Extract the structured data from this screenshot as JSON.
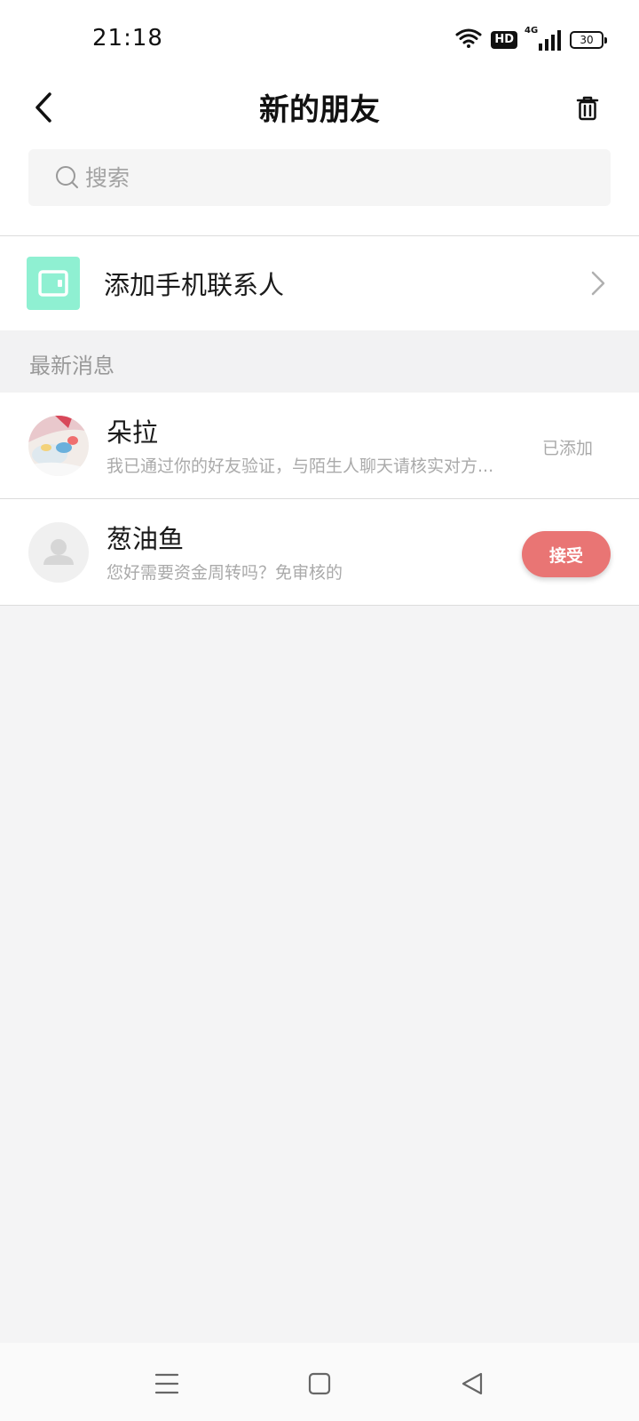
{
  "status_bar": {
    "time": "21:18",
    "hd_label": "HD",
    "network": "4G",
    "battery": "30"
  },
  "header": {
    "title": "新的朋友",
    "back_icon": "back-arrow-icon",
    "trash_icon": "trash-icon"
  },
  "search": {
    "placeholder": "搜索",
    "value": ""
  },
  "add_contact": {
    "label": "添加手机联系人",
    "icon": "contacts-book-icon",
    "icon_color": "#8ff0d2"
  },
  "section": {
    "label": "最新消息"
  },
  "friends": [
    {
      "name": "朵拉",
      "message": "我已通过你的好友验证，与陌生人聊天请核实对方...",
      "status": "已添加",
      "avatar": "photo"
    },
    {
      "name": "葱油鱼",
      "message": "您好需要资金周转吗？免审核的",
      "action": "接受",
      "avatar": "default-user-icon"
    }
  ],
  "colors": {
    "accept_button": "#e97574",
    "page_background": "#f4f4f5"
  }
}
